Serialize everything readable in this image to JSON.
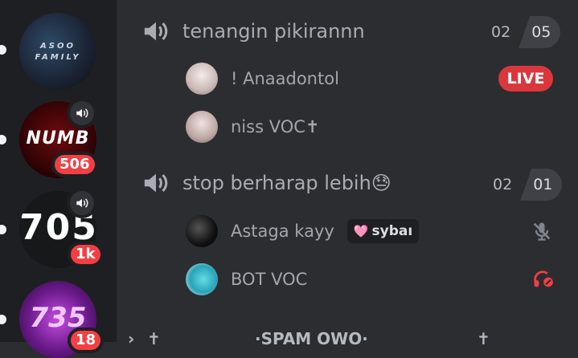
{
  "servers": [
    {
      "name": "ASOO FAMILY",
      "label_lines": [
        "ASOO",
        "FAMILY"
      ],
      "count": ""
    },
    {
      "name": "NUMB",
      "label_lines": [
        "NUMB"
      ],
      "count": "506"
    },
    {
      "name": "705",
      "label_lines": [
        "705"
      ],
      "count": "1k"
    },
    {
      "name": "735",
      "label_lines": [
        "735"
      ],
      "count": "18"
    }
  ],
  "channels": [
    {
      "name": "tenangin pikirannn",
      "user_count": "02",
      "user_limit": "05",
      "users": [
        {
          "name": "! Anaadontol",
          "badge": "LIVE"
        },
        {
          "name": "niss VOC✝",
          "badge": ""
        }
      ]
    },
    {
      "name": "stop berharap lebih😓",
      "user_count": "02",
      "user_limit": "01",
      "users": [
        {
          "name": "Astaga kayy",
          "tag": "sybaı",
          "tag_emoji": "🩷",
          "status_icon": "muted-mic-icon"
        },
        {
          "name": "BOT VOC",
          "status_icon": "deafened-headset-icon"
        }
      ]
    }
  ],
  "partial_channel": {
    "name": "·SPAM OWO·"
  },
  "colors": {
    "live": "#da373c",
    "badge": "#f23f43",
    "deafen": "#f23f43"
  }
}
